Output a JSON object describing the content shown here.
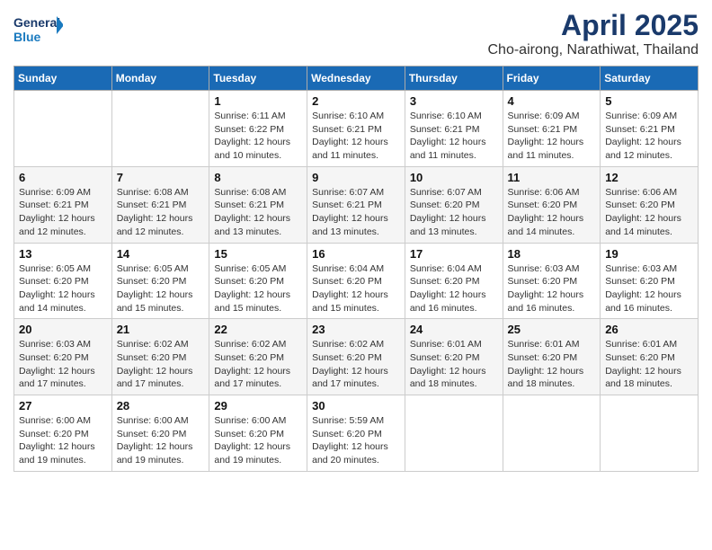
{
  "header": {
    "logo_general": "General",
    "logo_blue": "Blue",
    "month_title": "April 2025",
    "location": "Cho-airong, Narathiwat, Thailand"
  },
  "weekdays": [
    "Sunday",
    "Monday",
    "Tuesday",
    "Wednesday",
    "Thursday",
    "Friday",
    "Saturday"
  ],
  "weeks": [
    [
      {
        "day": "",
        "detail": ""
      },
      {
        "day": "",
        "detail": ""
      },
      {
        "day": "1",
        "detail": "Sunrise: 6:11 AM\nSunset: 6:22 PM\nDaylight: 12 hours\nand 10 minutes."
      },
      {
        "day": "2",
        "detail": "Sunrise: 6:10 AM\nSunset: 6:21 PM\nDaylight: 12 hours\nand 11 minutes."
      },
      {
        "day": "3",
        "detail": "Sunrise: 6:10 AM\nSunset: 6:21 PM\nDaylight: 12 hours\nand 11 minutes."
      },
      {
        "day": "4",
        "detail": "Sunrise: 6:09 AM\nSunset: 6:21 PM\nDaylight: 12 hours\nand 11 minutes."
      },
      {
        "day": "5",
        "detail": "Sunrise: 6:09 AM\nSunset: 6:21 PM\nDaylight: 12 hours\nand 12 minutes."
      }
    ],
    [
      {
        "day": "6",
        "detail": "Sunrise: 6:09 AM\nSunset: 6:21 PM\nDaylight: 12 hours\nand 12 minutes."
      },
      {
        "day": "7",
        "detail": "Sunrise: 6:08 AM\nSunset: 6:21 PM\nDaylight: 12 hours\nand 12 minutes."
      },
      {
        "day": "8",
        "detail": "Sunrise: 6:08 AM\nSunset: 6:21 PM\nDaylight: 12 hours\nand 13 minutes."
      },
      {
        "day": "9",
        "detail": "Sunrise: 6:07 AM\nSunset: 6:21 PM\nDaylight: 12 hours\nand 13 minutes."
      },
      {
        "day": "10",
        "detail": "Sunrise: 6:07 AM\nSunset: 6:20 PM\nDaylight: 12 hours\nand 13 minutes."
      },
      {
        "day": "11",
        "detail": "Sunrise: 6:06 AM\nSunset: 6:20 PM\nDaylight: 12 hours\nand 14 minutes."
      },
      {
        "day": "12",
        "detail": "Sunrise: 6:06 AM\nSunset: 6:20 PM\nDaylight: 12 hours\nand 14 minutes."
      }
    ],
    [
      {
        "day": "13",
        "detail": "Sunrise: 6:05 AM\nSunset: 6:20 PM\nDaylight: 12 hours\nand 14 minutes."
      },
      {
        "day": "14",
        "detail": "Sunrise: 6:05 AM\nSunset: 6:20 PM\nDaylight: 12 hours\nand 15 minutes."
      },
      {
        "day": "15",
        "detail": "Sunrise: 6:05 AM\nSunset: 6:20 PM\nDaylight: 12 hours\nand 15 minutes."
      },
      {
        "day": "16",
        "detail": "Sunrise: 6:04 AM\nSunset: 6:20 PM\nDaylight: 12 hours\nand 15 minutes."
      },
      {
        "day": "17",
        "detail": "Sunrise: 6:04 AM\nSunset: 6:20 PM\nDaylight: 12 hours\nand 16 minutes."
      },
      {
        "day": "18",
        "detail": "Sunrise: 6:03 AM\nSunset: 6:20 PM\nDaylight: 12 hours\nand 16 minutes."
      },
      {
        "day": "19",
        "detail": "Sunrise: 6:03 AM\nSunset: 6:20 PM\nDaylight: 12 hours\nand 16 minutes."
      }
    ],
    [
      {
        "day": "20",
        "detail": "Sunrise: 6:03 AM\nSunset: 6:20 PM\nDaylight: 12 hours\nand 17 minutes."
      },
      {
        "day": "21",
        "detail": "Sunrise: 6:02 AM\nSunset: 6:20 PM\nDaylight: 12 hours\nand 17 minutes."
      },
      {
        "day": "22",
        "detail": "Sunrise: 6:02 AM\nSunset: 6:20 PM\nDaylight: 12 hours\nand 17 minutes."
      },
      {
        "day": "23",
        "detail": "Sunrise: 6:02 AM\nSunset: 6:20 PM\nDaylight: 12 hours\nand 17 minutes."
      },
      {
        "day": "24",
        "detail": "Sunrise: 6:01 AM\nSunset: 6:20 PM\nDaylight: 12 hours\nand 18 minutes."
      },
      {
        "day": "25",
        "detail": "Sunrise: 6:01 AM\nSunset: 6:20 PM\nDaylight: 12 hours\nand 18 minutes."
      },
      {
        "day": "26",
        "detail": "Sunrise: 6:01 AM\nSunset: 6:20 PM\nDaylight: 12 hours\nand 18 minutes."
      }
    ],
    [
      {
        "day": "27",
        "detail": "Sunrise: 6:00 AM\nSunset: 6:20 PM\nDaylight: 12 hours\nand 19 minutes."
      },
      {
        "day": "28",
        "detail": "Sunrise: 6:00 AM\nSunset: 6:20 PM\nDaylight: 12 hours\nand 19 minutes."
      },
      {
        "day": "29",
        "detail": "Sunrise: 6:00 AM\nSunset: 6:20 PM\nDaylight: 12 hours\nand 19 minutes."
      },
      {
        "day": "30",
        "detail": "Sunrise: 5:59 AM\nSunset: 6:20 PM\nDaylight: 12 hours\nand 20 minutes."
      },
      {
        "day": "",
        "detail": ""
      },
      {
        "day": "",
        "detail": ""
      },
      {
        "day": "",
        "detail": ""
      }
    ]
  ]
}
